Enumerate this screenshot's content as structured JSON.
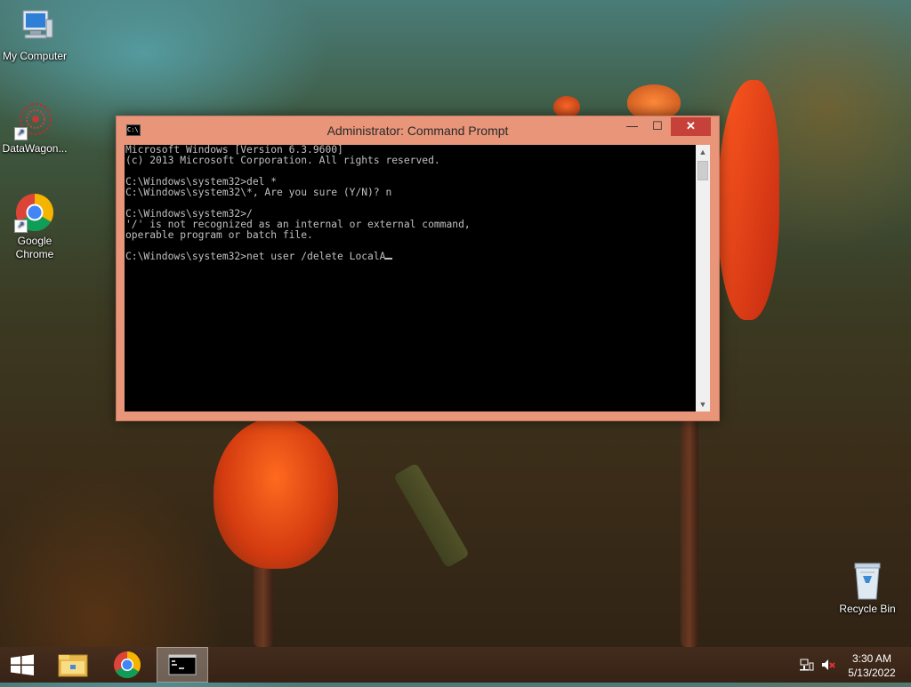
{
  "desktop": {
    "icons": [
      {
        "label": "My Computer",
        "icon": "computer-icon"
      },
      {
        "label": "DataWagon...",
        "icon": "datawagon-icon"
      },
      {
        "label": "Google Chrome",
        "icon": "chrome-icon"
      },
      {
        "label": "Recycle Bin",
        "icon": "recycle-bin-icon"
      }
    ]
  },
  "window": {
    "title": "Administrator: Command Prompt",
    "title_icon_text": "C:\\",
    "minimize_glyph": "—",
    "maximize_glyph": "☐",
    "close_glyph": "✕",
    "console_lines": [
      "Microsoft Windows [Version 6.3.9600]",
      "(c) 2013 Microsoft Corporation. All rights reserved.",
      "",
      "C:\\Windows\\system32>del *",
      "C:\\Windows\\system32\\*, Are you sure (Y/N)? n",
      "",
      "C:\\Windows\\system32>/",
      "'/' is not recognized as an internal or external command,",
      "operable program or batch file.",
      "",
      "C:\\Windows\\system32>net user /delete LocalA"
    ],
    "scroll_up_glyph": "▲",
    "scroll_down_glyph": "▼"
  },
  "taskbar": {
    "items": [
      "start",
      "file-explorer",
      "google-chrome",
      "command-prompt"
    ],
    "active_item": "command-prompt",
    "clock_time": "3:30 AM",
    "clock_date": "5/13/2022"
  },
  "colors": {
    "window_frame": "#e8957a",
    "close_button": "#c7413b",
    "console_bg": "#000000",
    "console_text": "#c0c0c0"
  }
}
